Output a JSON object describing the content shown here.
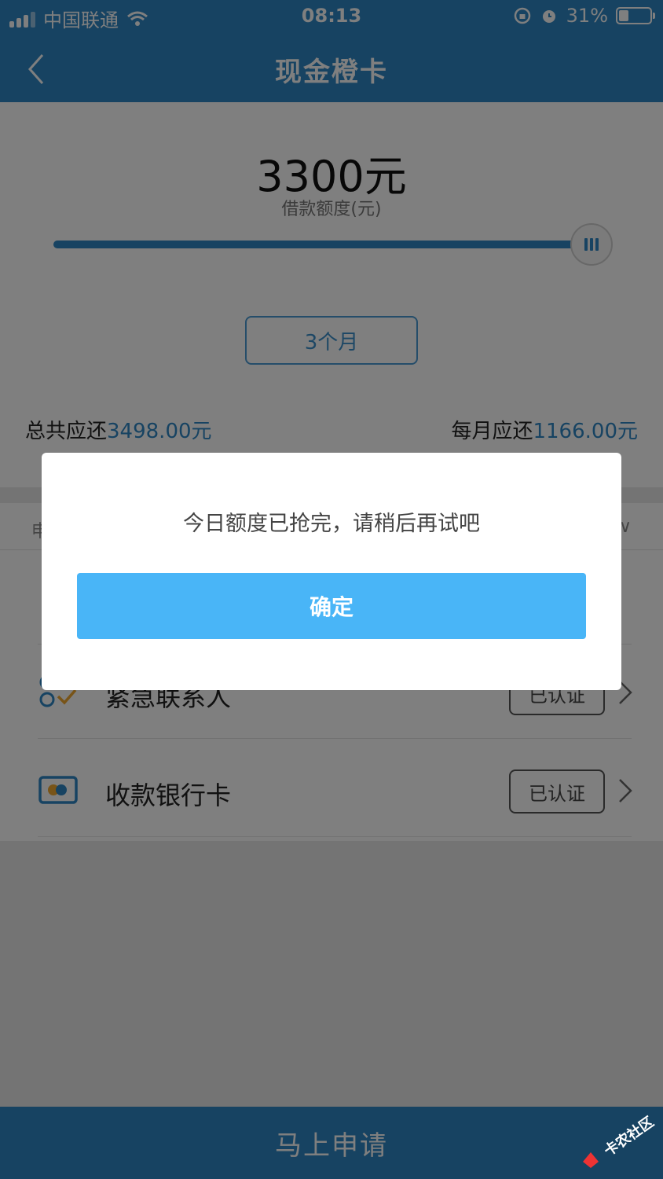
{
  "status_bar": {
    "carrier": "中国联通",
    "time": "08:13",
    "battery": "31%",
    "battery_level": 0.31
  },
  "nav": {
    "title": "现金橙卡",
    "back_icon": "chevron-left-icon"
  },
  "loan": {
    "amount": "3300元",
    "amount_label": "借款额度(元)",
    "slider_level": 1.0,
    "term": "3个月",
    "total_label": "总共应还",
    "total_value": "3498.00元",
    "monthly_label": "每月应还",
    "monthly_value": "1166.00元"
  },
  "list": {
    "header_text": "申",
    "items": [
      {
        "label": "紧急联系人",
        "badge": "已认证",
        "icon": "contacts-check-icon"
      },
      {
        "label": "收款银行卡",
        "badge": "已认证",
        "icon": "bank-card-icon"
      }
    ]
  },
  "apply_button": "马上申请",
  "watermark": "卡农社区",
  "modal": {
    "message": "今日额度已抢完，请稍后再试吧",
    "confirm": "确定"
  },
  "colors": {
    "primary": "#2e87c5",
    "modal_button": "#49b5f7"
  }
}
